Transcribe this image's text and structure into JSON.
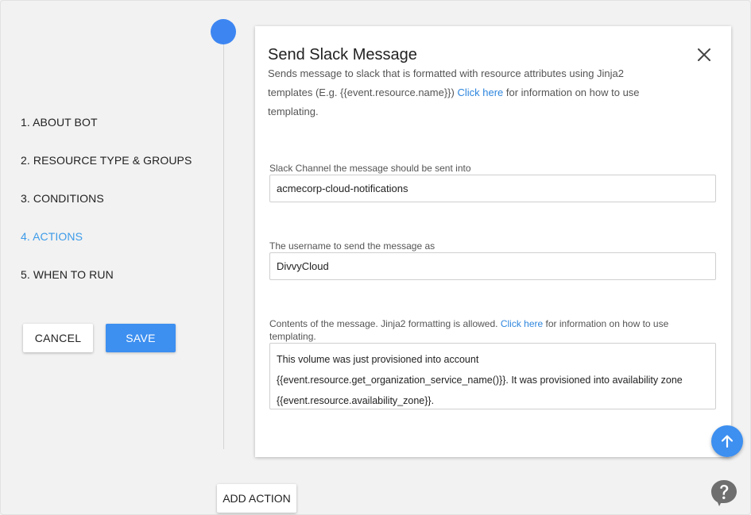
{
  "steps": [
    {
      "label": "1. ABOUT BOT"
    },
    {
      "label": "2. RESOURCE TYPE & GROUPS"
    },
    {
      "label": "3. CONDITIONS"
    },
    {
      "label": "4. ACTIONS"
    },
    {
      "label": "5. WHEN TO RUN"
    }
  ],
  "active_step": 3,
  "buttons": {
    "cancel": "CANCEL",
    "save": "SAVE",
    "add_action": "ADD ACTION"
  },
  "card": {
    "title": "Send Slack Message",
    "description_prefix": "Sends message to slack that is formatted with resource attributes using Jinja2 templates (E.g. {{event.resource.name}}) ",
    "description_link": "Click here",
    "description_suffix": " for information on how to use templating.",
    "fields": {
      "channel": {
        "label": "Slack Channel the message should be sent into",
        "value": "acmecorp-cloud-notifications"
      },
      "username": {
        "label": "The username to send the message as",
        "value": "DivvyCloud"
      },
      "message": {
        "label_prefix": "Contents of the message. Jinja2 formatting is allowed. ",
        "label_link": "Click here",
        "label_suffix": " for information on how to use templating.",
        "lines": [
          "This volume was just provisioned into account",
          "{{event.resource.get_organization_service_name()}}. It was provisioned into availability zone",
          "{{event.resource.availability_zone}}."
        ]
      }
    }
  },
  "icons": {
    "close": "close-icon",
    "scroll_top": "arrow-up-icon",
    "help": "question-mark-icon"
  },
  "colors": {
    "accent": "#3d8ff0",
    "active_step": "#3d9be9",
    "link": "#2e86de",
    "help_icon": "#6f6f6f"
  }
}
